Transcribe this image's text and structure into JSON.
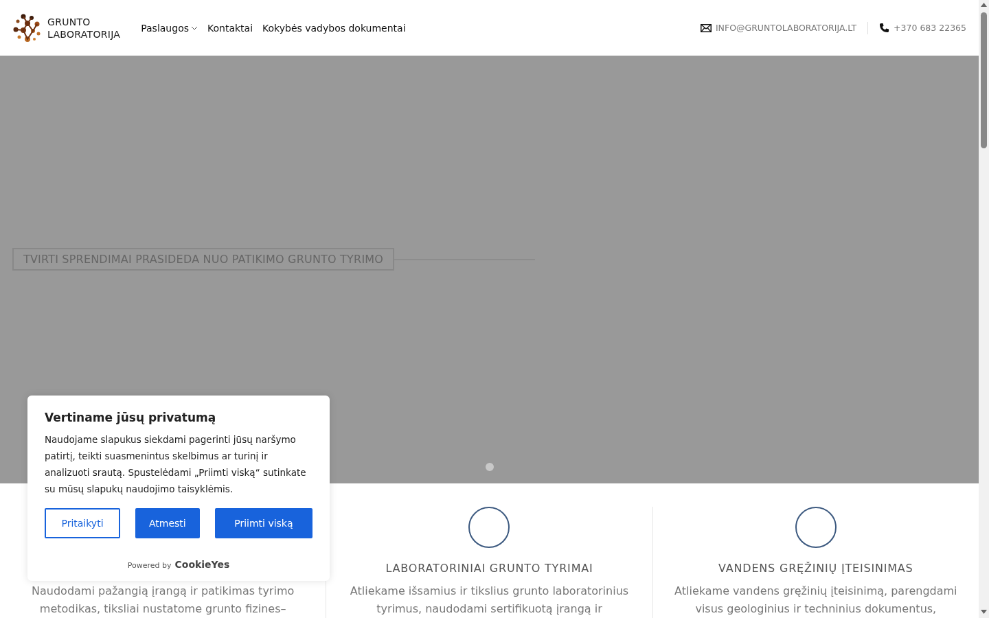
{
  "header": {
    "logo_lines": [
      "GRUNTO",
      "LABORATORIJA"
    ],
    "nav": [
      {
        "label": "Paslaugos",
        "has_dropdown": true
      },
      {
        "label": "Kontaktai",
        "has_dropdown": false
      },
      {
        "label": "Kokybės vadybos dokumentai",
        "has_dropdown": false
      }
    ],
    "email": "INFO@GRUNTOLABORATORIJA.LT",
    "phone": "+370 683 22365"
  },
  "hero": {
    "headline": "TVIRTI SPRENDIMAI PRASIDEDA NUO PATIKIMO GRUNTO TYRIMO",
    "slides": [
      {
        "selected": true
      }
    ]
  },
  "features": [
    {
      "text": "Naudodami pažangią įrangą ir patikimas tyrimo metodikas, tiksliai nustatome grunto fizines–"
    },
    {
      "title": "LABORATORINIAI GRUNTO TYRIMAI",
      "text": "Atliekame išsamius ir tikslius grunto laboratorinius tyrimus, naudodami sertifikuotą įrangą ir"
    },
    {
      "title": "VANDENS GRĘŽINIŲ ĮTEISINIMAS",
      "text": "Atliekame vandens gręžinių įteisinimą, parengdami visus geologinius ir techninius dokumentus,"
    }
  ],
  "cookie_banner": {
    "title": "Vertiname jūsų privatumą",
    "text": "Naudojame slapukus siekdami pagerinti jūsų naršymo patirtį, teikti suasmenintus skelbimus ar turinį ir analizuoti srautą. Spustelėdami „Priimti viską“ sutinkate su mūsų slapukų naudojimo taisyklėmis.",
    "buttons": [
      {
        "label": "Pritaikyti",
        "kind": "outline"
      },
      {
        "label": "Atmesti",
        "kind": "filled"
      },
      {
        "label": "Priimti viską",
        "kind": "filled"
      }
    ],
    "powered_by": "Powered by",
    "brand": "CookieYes"
  }
}
